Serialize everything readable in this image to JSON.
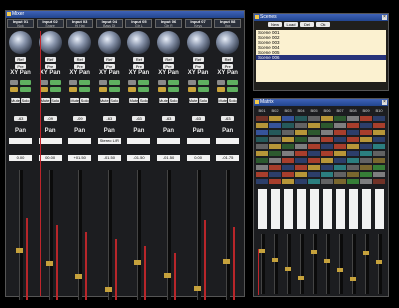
{
  "mixer": {
    "title": "Mixer",
    "channels": [
      {
        "name": "Input 01",
        "sub": "Kick",
        "value": "-63",
        "disp": "0.00"
      },
      {
        "name": "Input 02",
        "sub": "Snare",
        "value": "-09",
        "disp": "00.00"
      },
      {
        "name": "Input 03",
        "sub": "Hi Hat",
        "value": "-09",
        "disp": "+01.50"
      },
      {
        "name": "Input 04",
        "sub": "Bass DI",
        "value": "-63",
        "disp": "-01.50"
      },
      {
        "name": "Input 05",
        "sub": "Gtr L",
        "value": "-63",
        "disp": "-01.50"
      },
      {
        "name": "Input 06",
        "sub": "Gtr R",
        "value": "-63",
        "disp": "-01.50"
      },
      {
        "name": "Input 07",
        "sub": "Keys",
        "value": "-63",
        "disp": "0.00"
      },
      {
        "name": "Input 08",
        "sub": "Vox",
        "value": "-63",
        "disp": "-01.75"
      }
    ],
    "buttons": {
      "a": "Ref",
      "b": "Pre",
      "c": "Mute",
      "d": "Solo"
    },
    "xy_label": "XY Pan",
    "pan_label": "Pan",
    "mode_label": "Stereo L/R"
  },
  "scenes": {
    "title": "Scenes",
    "toolbar": [
      "New",
      "Load",
      "Del",
      "Ok"
    ],
    "items": [
      "Scene 001",
      "Scene 002",
      "Scene 003",
      "Scene 004",
      "Scene 005",
      "Scene 006"
    ],
    "selected_index": 5
  },
  "buses": {
    "title": "Matrix",
    "columns": [
      "B01",
      "B02",
      "B03",
      "B04",
      "B05",
      "B06",
      "B07",
      "B08",
      "B09",
      "B10"
    ],
    "accent": "#c0252b"
  }
}
